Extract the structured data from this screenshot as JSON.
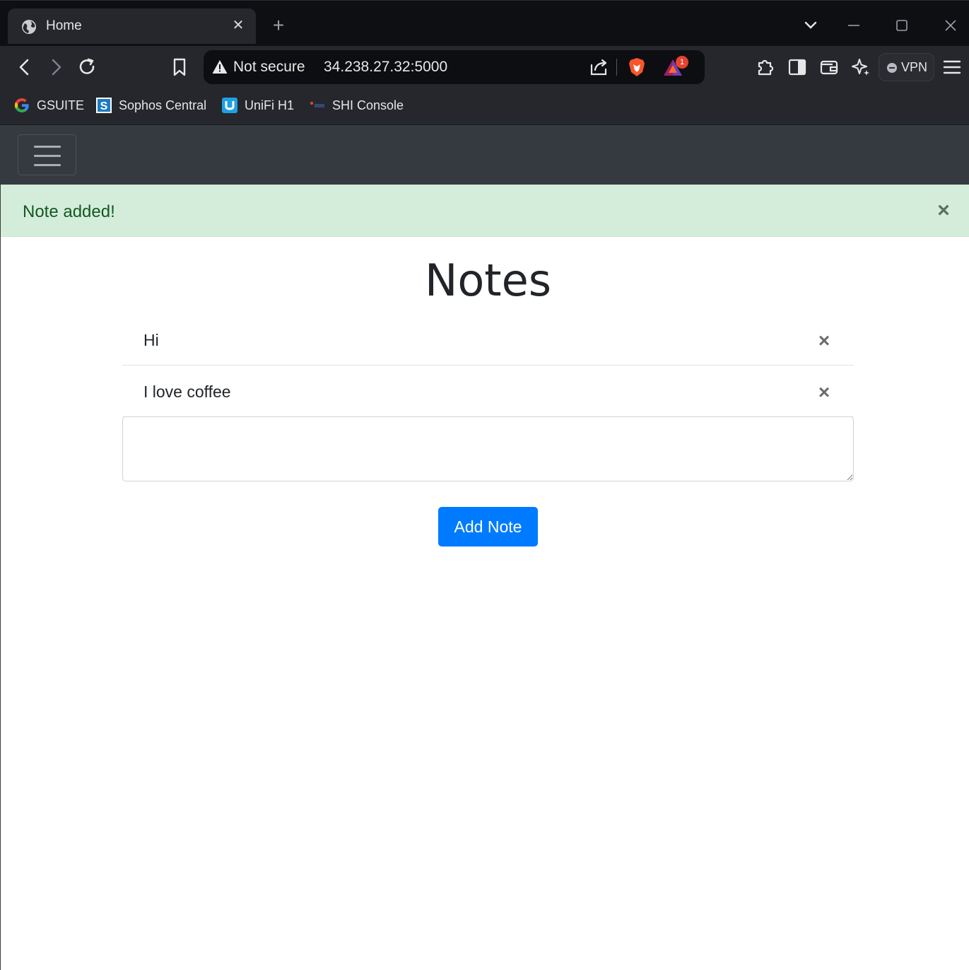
{
  "browser": {
    "tab": {
      "title": "Home",
      "close_glyph": "✕",
      "icon": "globe-icon"
    },
    "new_tab_glyph": "+",
    "omnibox": {
      "security_label": "Not secure",
      "url": "34.238.27.32:5000"
    },
    "brave_rewards_badge": "1",
    "vpn_label": "VPN",
    "bookmarks": [
      {
        "label": "GSUITE",
        "icon": "google-icon"
      },
      {
        "label": "Sophos Central",
        "icon": "sophos-icon"
      },
      {
        "label": "UniFi H1",
        "icon": "unifi-icon"
      },
      {
        "label": "SHI Console",
        "icon": "shi-icon"
      }
    ]
  },
  "app": {
    "alert": {
      "message": "Note added!",
      "close_glyph": "×"
    },
    "title": "Notes",
    "notes": [
      {
        "text": "Hi",
        "delete_glyph": "×"
      },
      {
        "text": "I love coffee",
        "delete_glyph": "×"
      }
    ],
    "note_input": {
      "value": "",
      "placeholder": ""
    },
    "add_button_label": "Add Note"
  },
  "colors": {
    "navbar_bg": "#343a40",
    "alert_bg": "#d4edda",
    "alert_text": "#155724",
    "primary": "#007bff"
  }
}
